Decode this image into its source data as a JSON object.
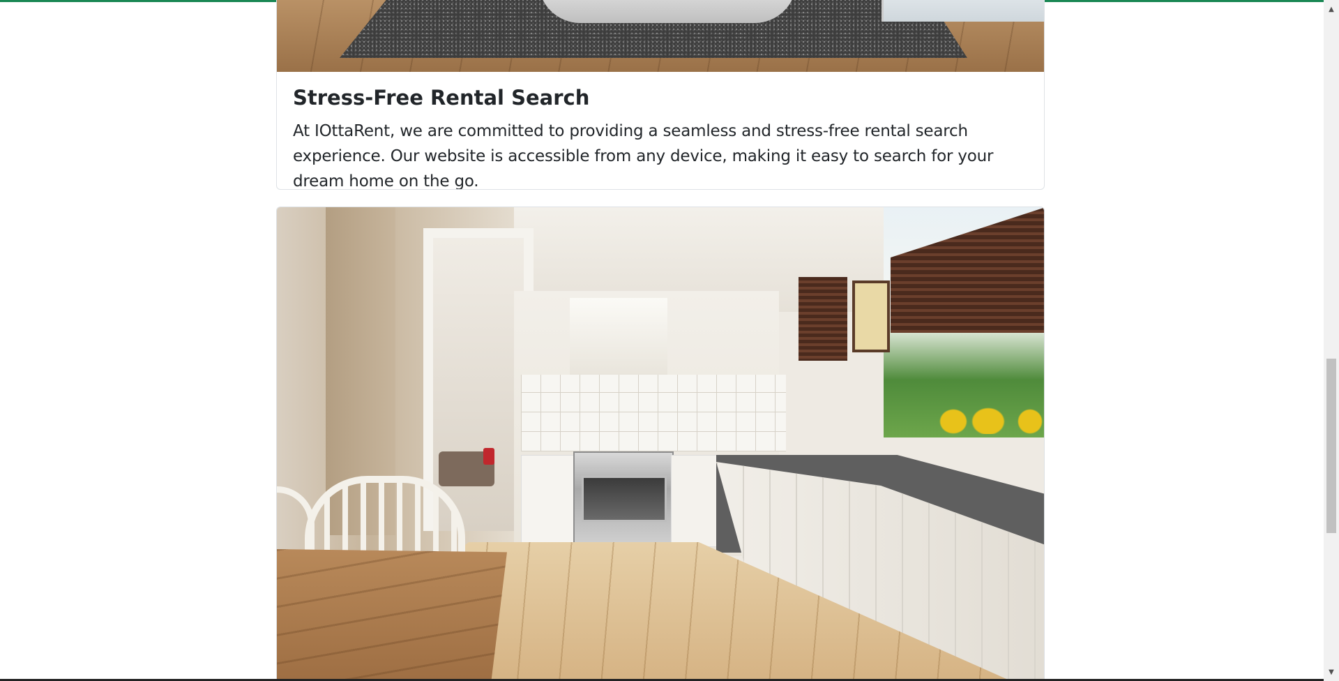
{
  "card1": {
    "image_alt": "Living room with grey rug and wooden floor",
    "title": "Stress-Free Rental Search",
    "text": "At IOttaRent, we are committed to providing a seamless and stress-free rental search experience. Our website is accessible from any device, making it easy to search for your dream home on the go."
  },
  "card2": {
    "image_alt": "Bright kitchen with white cabinets, stainless stove and wooden floor"
  },
  "scrollbar": {
    "up_icon": "▲",
    "down_icon": "▼",
    "position_fraction": 0.55
  },
  "colors": {
    "accent": "#198754",
    "text": "#212529",
    "card_border": "#dee2e6"
  }
}
